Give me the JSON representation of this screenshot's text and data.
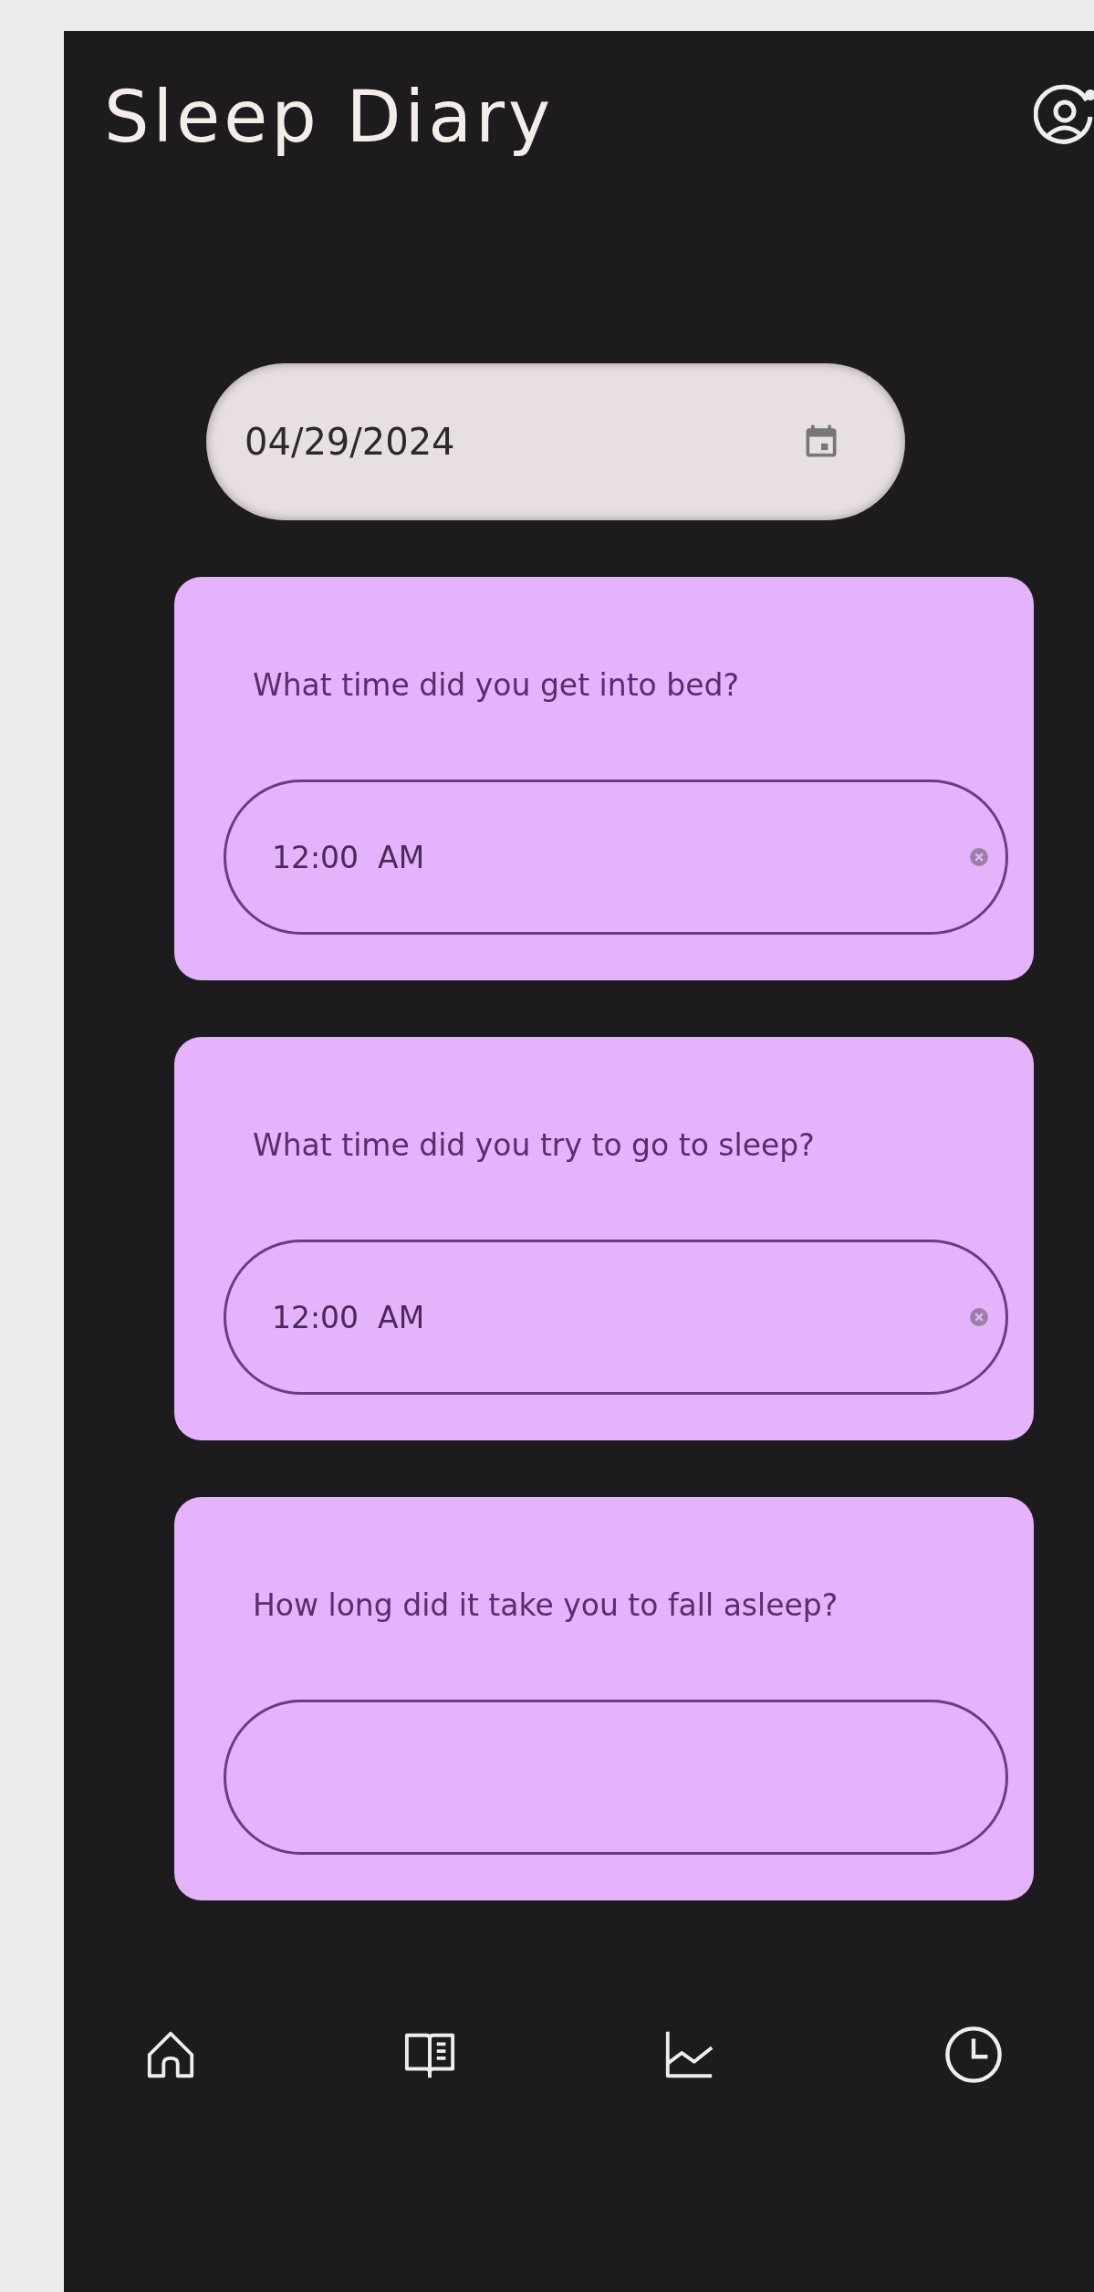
{
  "header": {
    "title": "Sleep Diary"
  },
  "date_field": {
    "value": "04/29/2024"
  },
  "questions": [
    {
      "kind": "time",
      "question": "What time did you get into bed?",
      "value": "12:00  AM"
    },
    {
      "kind": "time",
      "question": "What time did you try to go to sleep?",
      "value": "12:00  AM"
    },
    {
      "kind": "text",
      "question": "How long did it take you to fall asleep?"
    }
  ]
}
